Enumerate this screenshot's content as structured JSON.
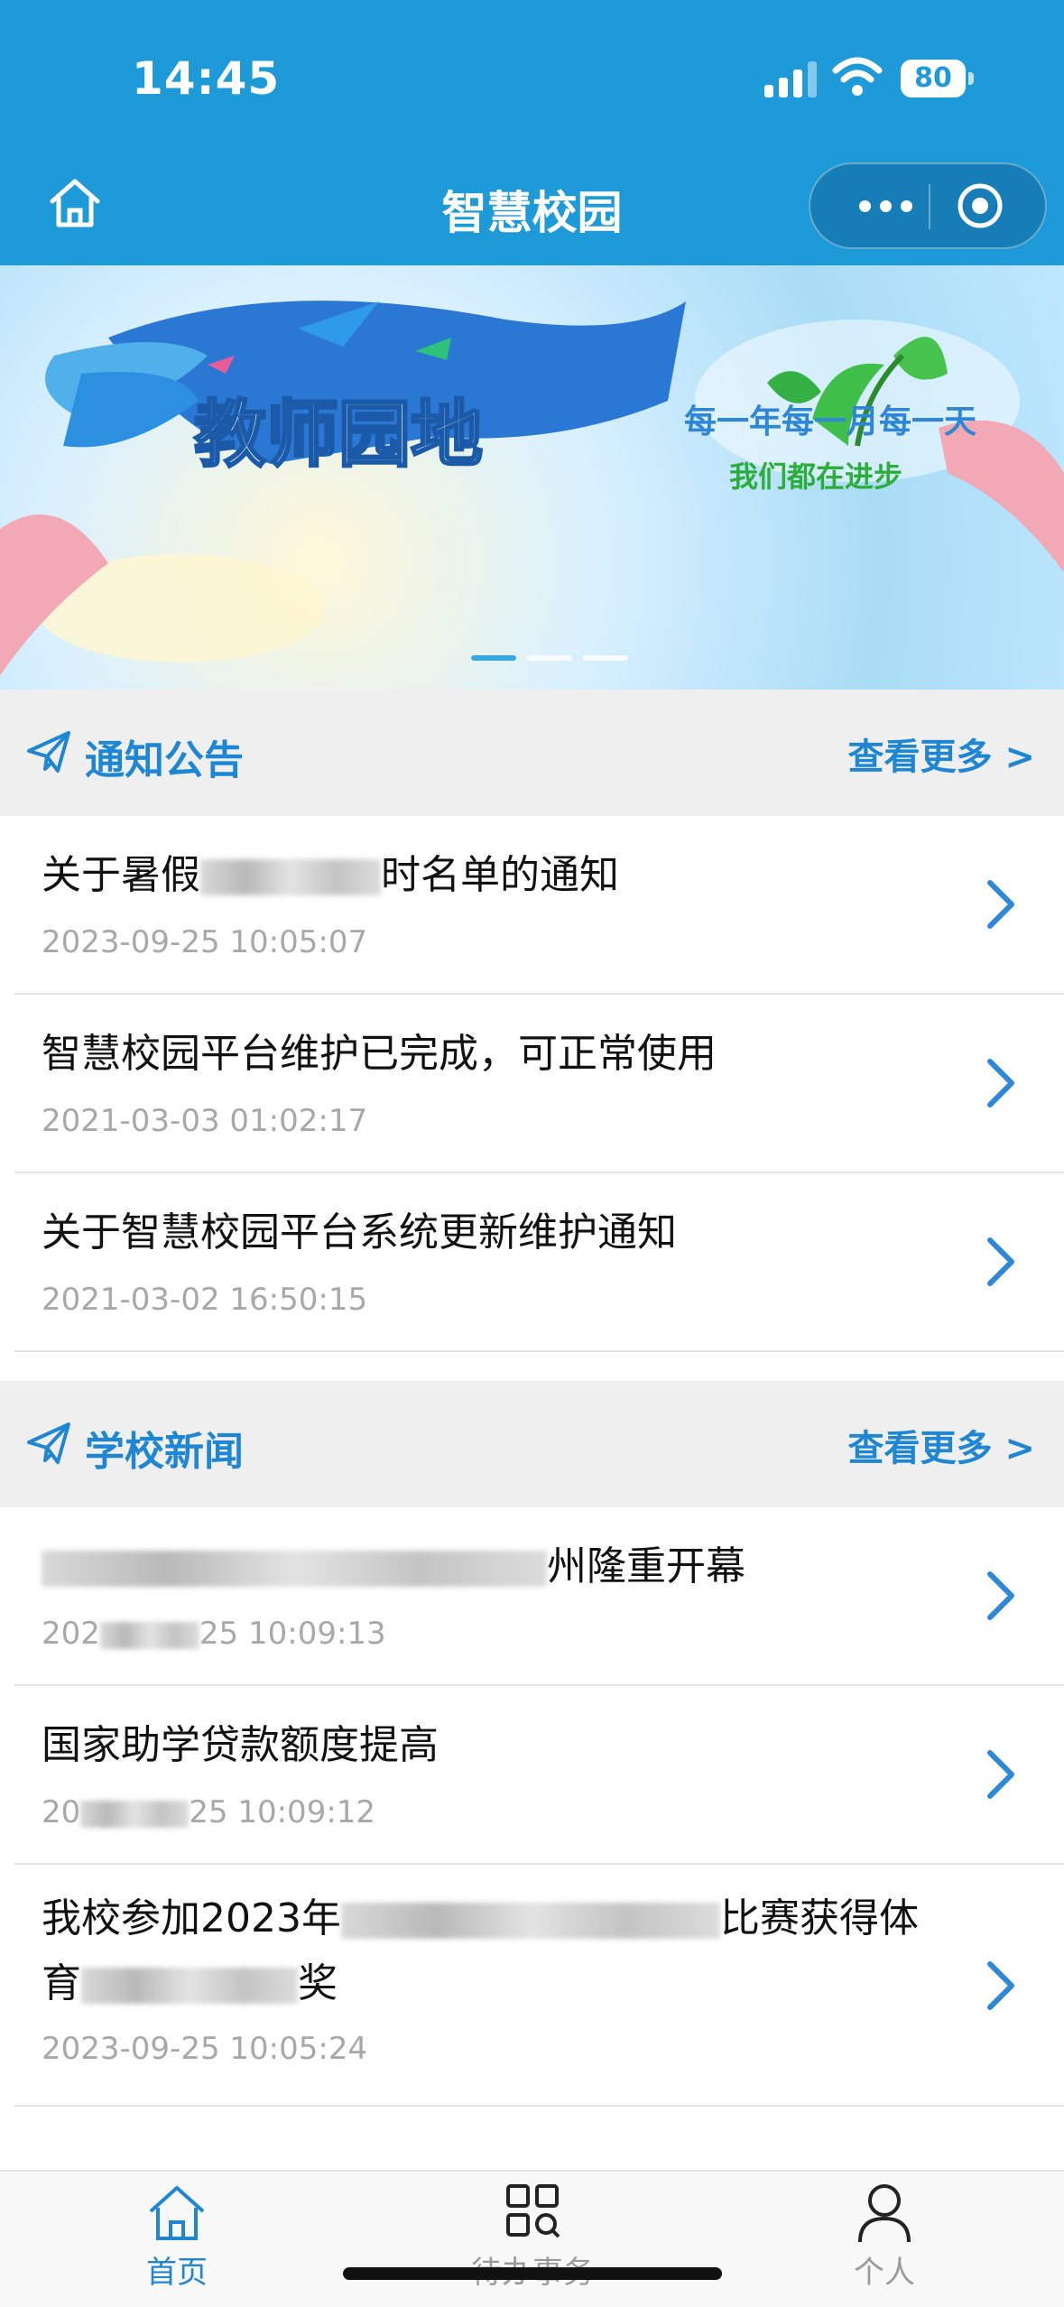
{
  "status_bar": {
    "time": "14:45",
    "battery": "80"
  },
  "nav_bar": {
    "title": "智慧校园"
  },
  "banner": {
    "title": "教师园地",
    "slogan_line1": "每一年每一月每一天",
    "slogan_line2": "我们都在进步"
  },
  "notices": {
    "header": "通知公告",
    "more": "查看更多 >",
    "items": [
      {
        "title_start": "关于暑假",
        "title_end": "时名单的通知",
        "time": "2023-09-25 10:05:07"
      },
      {
        "title": "智慧校园平台维护已完成，可正常使用",
        "time": "2021-03-03 01:02:17"
      },
      {
        "title": "关于智慧校园平台系统更新维护通知",
        "time": "2021-03-02 16:50:15"
      }
    ]
  },
  "news": {
    "header": "学校新闻",
    "more": "查看更多 >",
    "items": [
      {
        "title_end": "州隆重开幕",
        "time_start": "202",
        "time_end": "25 10:09:13"
      },
      {
        "title": "国家助学贷款额度提高",
        "time_start": "20",
        "time_end": "25 10:09:12"
      },
      {
        "title_start": "我校参加2023年",
        "title_mid": "比赛获得体",
        "title_line2_start": "育",
        "title_line2_end": "奖",
        "time": "2023-09-25 10:05:24"
      }
    ]
  },
  "tabbar": {
    "tabs": [
      {
        "label": "首页"
      },
      {
        "label": "待办事务"
      },
      {
        "label": "个人"
      }
    ]
  }
}
